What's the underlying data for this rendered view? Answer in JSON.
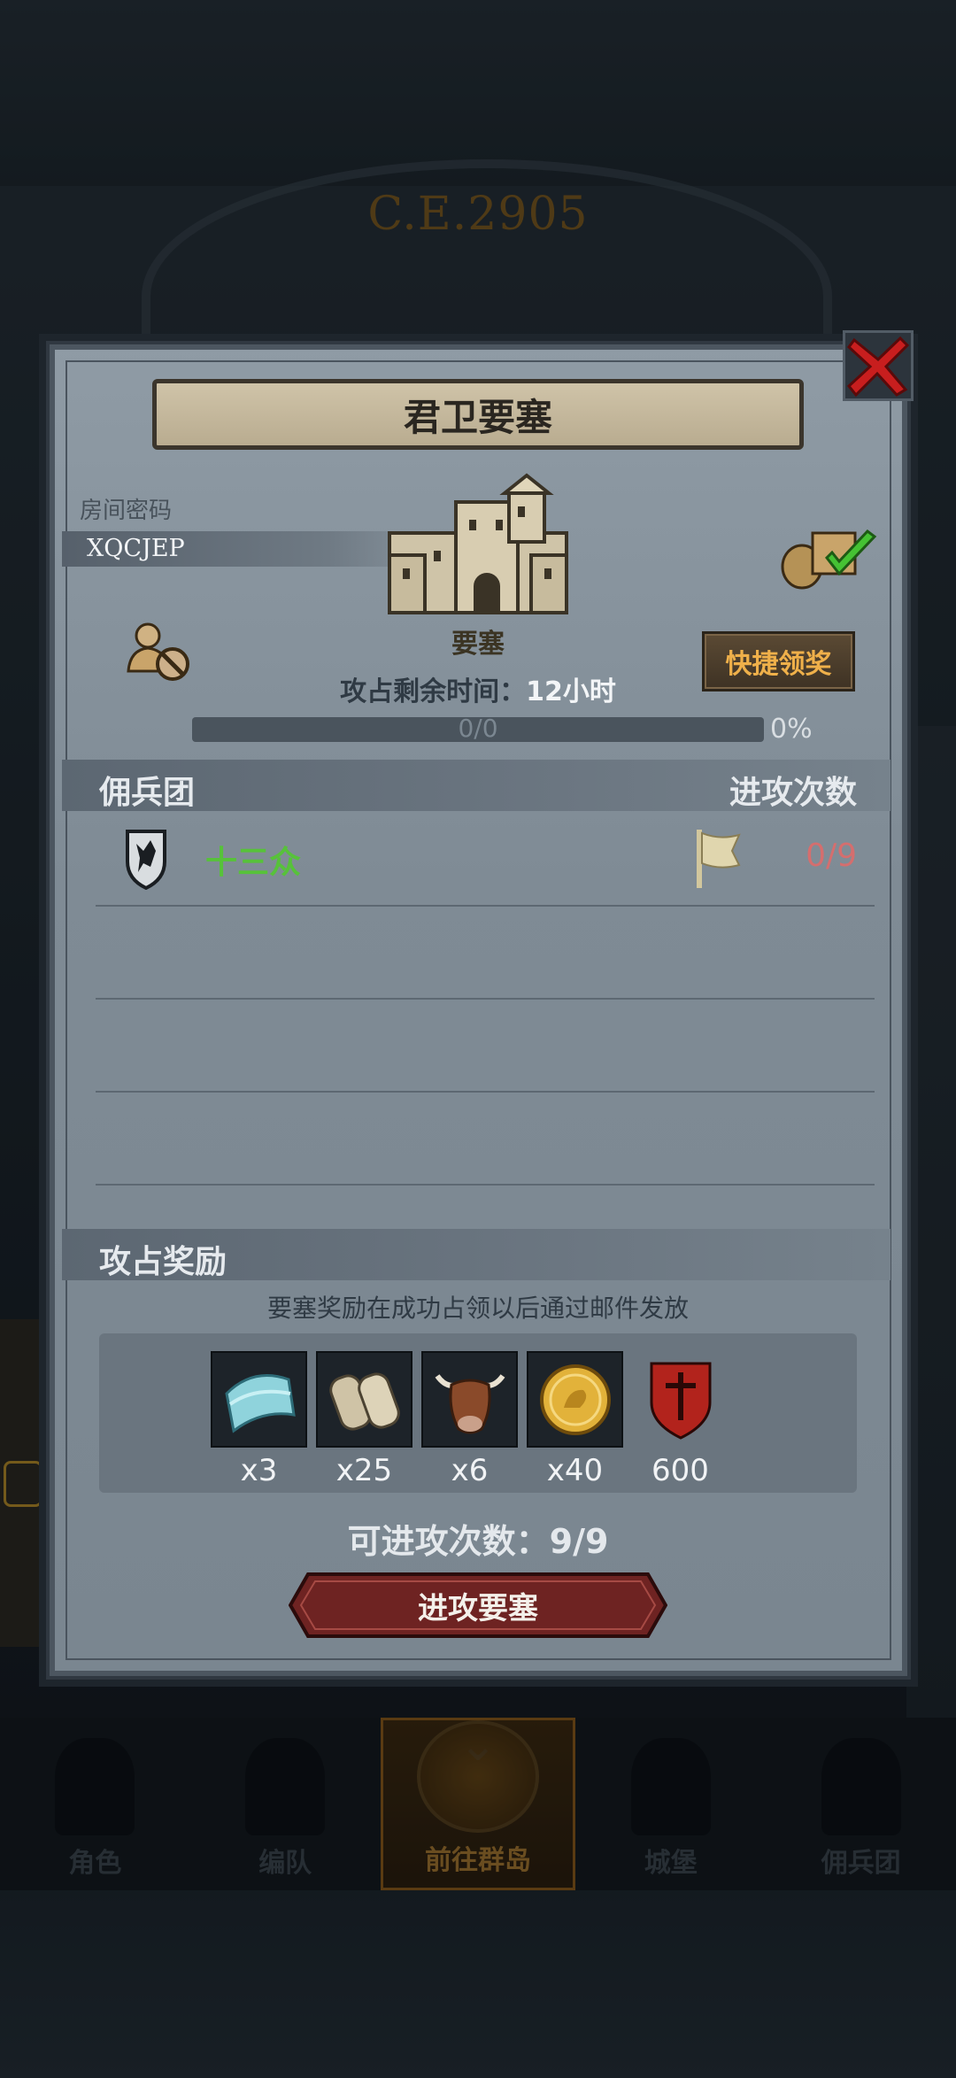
{
  "background": {
    "era": "C.E.2905"
  },
  "nav": {
    "items": [
      {
        "label": "角色",
        "icon": "knight-icon"
      },
      {
        "label": "编队",
        "icon": "formation-icon"
      },
      {
        "label": "前往群岛",
        "icon": "islands-icon",
        "active": true
      },
      {
        "label": "城堡",
        "icon": "castle-icon"
      },
      {
        "label": "佣兵团",
        "icon": "mercenary-icon"
      }
    ]
  },
  "dialog": {
    "title": "君卫要塞",
    "room_label": "房间密码",
    "room_code": "XQCJEP",
    "fortress_label": "要塞",
    "quick_claim": "快捷领奖",
    "time_label": "攻占剩余时间：",
    "time_value": "12小时",
    "progress_text": "0/0",
    "progress_fraction": 0,
    "progress_percent": "0%",
    "guild_header": "佣兵团",
    "attack_header": "进攻次数",
    "guilds": [
      {
        "name": "十三众",
        "attacks": "0/9"
      }
    ],
    "reward_header": "攻占奖励",
    "reward_note": "要塞奖励在成功占领以后通过邮件发放",
    "rewards": [
      {
        "icon": "cloth-icon",
        "qty": "x3"
      },
      {
        "icon": "scroll-icon",
        "qty": "x25"
      },
      {
        "icon": "bull-icon",
        "qty": "x6"
      },
      {
        "icon": "gold-coin-icon",
        "qty": "x40"
      },
      {
        "icon": "guild-emblem-icon",
        "qty": "600"
      }
    ],
    "attempts_label": "可进攻次数：",
    "attempts_value": "9/9",
    "attack_button": "进攻要塞"
  },
  "colors": {
    "guild_name": "#57c23a",
    "attack_count": "#d56e6e",
    "quick_claim_text": "#efb04a",
    "close_x": "#c81e1e"
  }
}
